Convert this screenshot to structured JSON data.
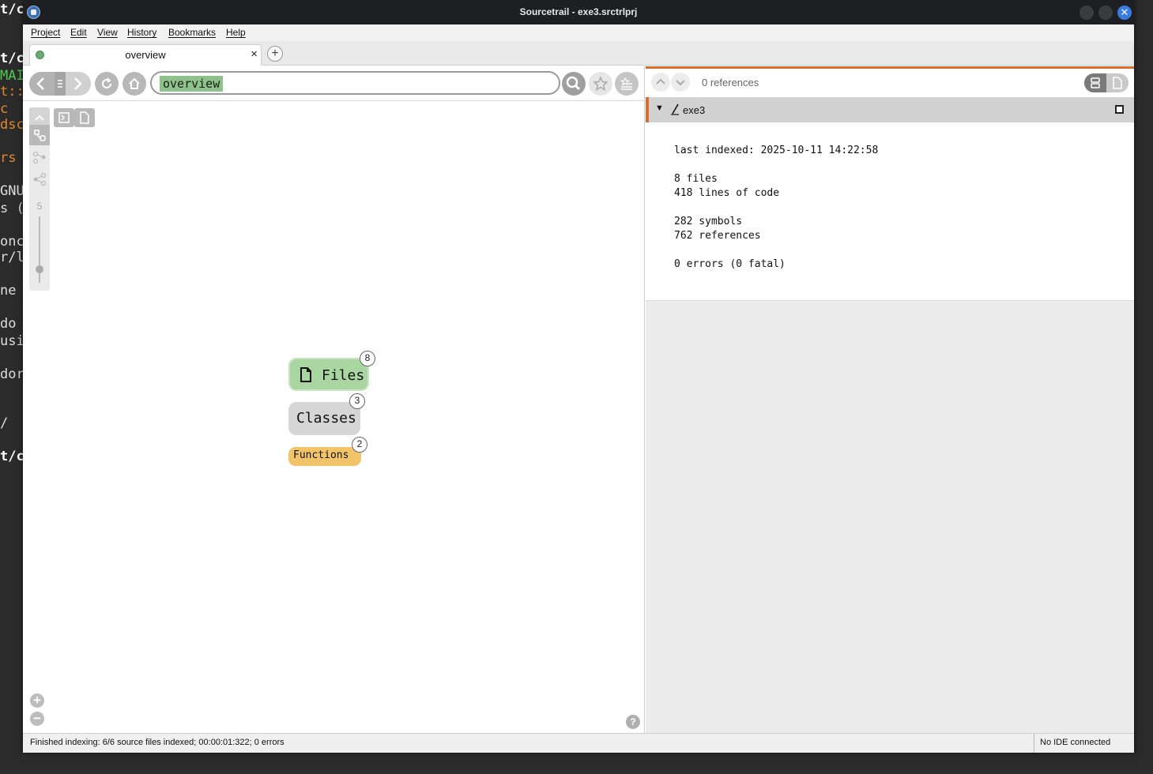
{
  "window": {
    "title": "Sourcetrail - exe3.srctrlprj"
  },
  "menu": [
    "Project",
    "Edit",
    "View",
    "History",
    "Bookmarks",
    "Help"
  ],
  "tab": {
    "label": "overview",
    "close": "×",
    "add": "+"
  },
  "search": {
    "token": "overview"
  },
  "graph": {
    "depth_value": "5",
    "nodes": {
      "files": {
        "label": "Files",
        "count": "8"
      },
      "classes": {
        "label": "Classes",
        "count": "3"
      },
      "functions": {
        "label": "Functions",
        "count": "2"
      }
    },
    "zoom_in": "+",
    "zoom_out": "−",
    "help": "?"
  },
  "code": {
    "references": "0 references",
    "file": {
      "name": "exe3",
      "lines": [
        "last indexed: 2025-10-11 14:22:58",
        "8 files",
        "418 lines of code",
        "282 symbols",
        "762 references",
        "0 errors (0 fatal)"
      ]
    }
  },
  "status": {
    "message": "Finished indexing: 6/6 source files indexed; 00:00:01:322; 0 errors",
    "ide": "No IDE connected"
  },
  "terminal": {
    "fragments": [
      "t/c",
      "MAI",
      "t::",
      "  c",
      "dsc",
      "rs",
      "GNU",
      "s (",
      "onc",
      "r/l",
      "ne",
      " do",
      "usi",
      "dor",
      " /",
      "t/c"
    ]
  },
  "colors": {
    "accent": "#e16a2a",
    "files_node": "#a9d6a0",
    "classes_node": "#d6d6d6",
    "functions_node": "#f2c46a",
    "search_token": "#8fc28a"
  }
}
